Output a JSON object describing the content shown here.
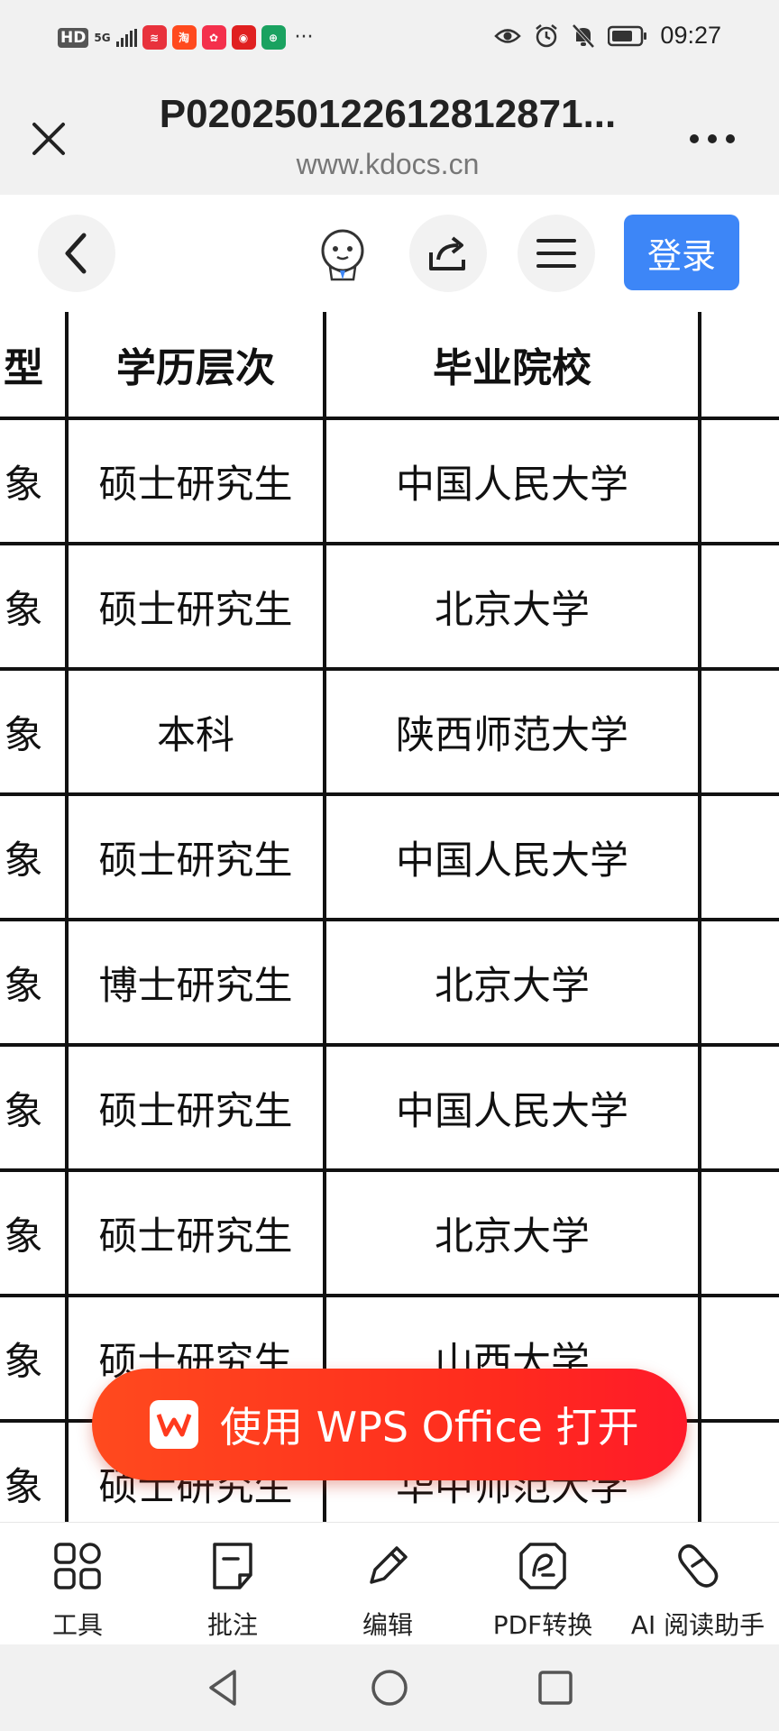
{
  "status_bar": {
    "hd_label": "HD",
    "network_label": "5G",
    "app_icons": [
      {
        "name": "app-icon-red",
        "color": "#e8323c",
        "glyph": "≋"
      },
      {
        "name": "taobao-icon",
        "color": "#ff4a1e",
        "glyph": "淘"
      },
      {
        "name": "app-icon-pink",
        "color": "#f4304c",
        "glyph": "✿"
      },
      {
        "name": "app-icon-redcircle",
        "color": "#e02020",
        "glyph": "◉"
      },
      {
        "name": "app-icon-green",
        "color": "#1aa260",
        "glyph": "⊕"
      }
    ],
    "more": "···",
    "time": "09:27"
  },
  "title_bar": {
    "title": "P020250122612812871...",
    "url": "www.kdocs.cn"
  },
  "doc_toolbar": {
    "login_label": "登录"
  },
  "table": {
    "headers": [
      "型",
      "学历层次",
      "毕业院校",
      ""
    ],
    "rows": [
      [
        "象",
        "硕士研究生",
        "中国人民大学"
      ],
      [
        "象",
        "硕士研究生",
        "北京大学"
      ],
      [
        "象",
        "本科",
        "陕西师范大学"
      ],
      [
        "象",
        "硕士研究生",
        "中国人民大学"
      ],
      [
        "象",
        "博士研究生",
        "北京大学"
      ],
      [
        "象",
        "硕士研究生",
        "中国人民大学"
      ],
      [
        "象",
        "硕士研究生",
        "北京大学"
      ],
      [
        "象",
        "硕士研究生",
        "山西大学"
      ],
      [
        "象",
        "硕士研究生",
        "华中师范大学"
      ]
    ]
  },
  "open_button": {
    "label": "使用 WPS Office 打开"
  },
  "bottom_toolbar": {
    "items": [
      {
        "label": "工具"
      },
      {
        "label": "批注"
      },
      {
        "label": "编辑"
      },
      {
        "label": "PDF转换"
      },
      {
        "label": "AI 阅读助手"
      }
    ]
  },
  "colors": {
    "login": "#3d86f7",
    "wps_button": "#ff3a1e",
    "grid": "#111111"
  }
}
